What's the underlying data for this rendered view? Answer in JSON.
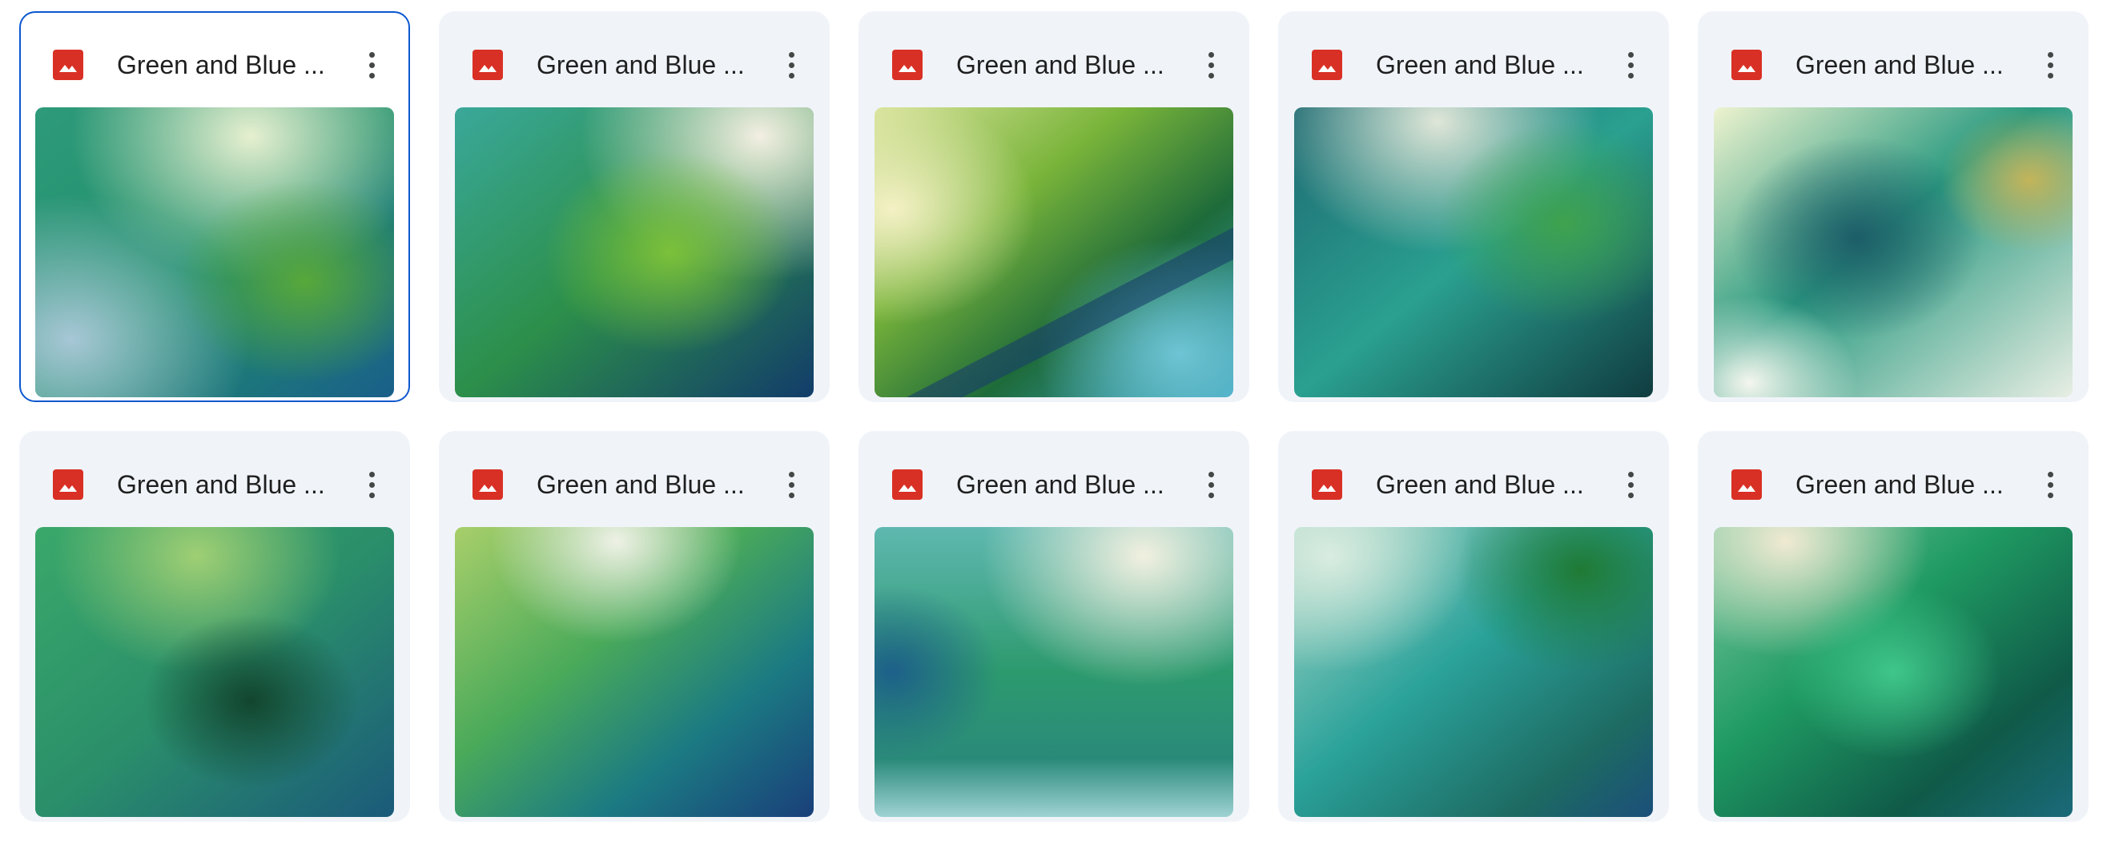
{
  "files": [
    {
      "name": "Green and Blue ...",
      "icon": "image-file-icon",
      "selected": true
    },
    {
      "name": "Green and Blue ...",
      "icon": "image-file-icon",
      "selected": false
    },
    {
      "name": "Green and Blue ...",
      "icon": "image-file-icon",
      "selected": false
    },
    {
      "name": "Green and Blue ...",
      "icon": "image-file-icon",
      "selected": false
    },
    {
      "name": "Green and Blue ...",
      "icon": "image-file-icon",
      "selected": false
    },
    {
      "name": "Green and Blue ...",
      "icon": "image-file-icon",
      "selected": false
    },
    {
      "name": "Green and Blue ...",
      "icon": "image-file-icon",
      "selected": false
    },
    {
      "name": "Green and Blue ...",
      "icon": "image-file-icon",
      "selected": false
    },
    {
      "name": "Green and Blue ...",
      "icon": "image-file-icon",
      "selected": false
    },
    {
      "name": "Green and Blue ...",
      "icon": "image-file-icon",
      "selected": false
    }
  ],
  "colors": {
    "card_bg": "#f0f4f9",
    "selected_border": "#0b57d0",
    "file_icon_red": "#d93025"
  }
}
